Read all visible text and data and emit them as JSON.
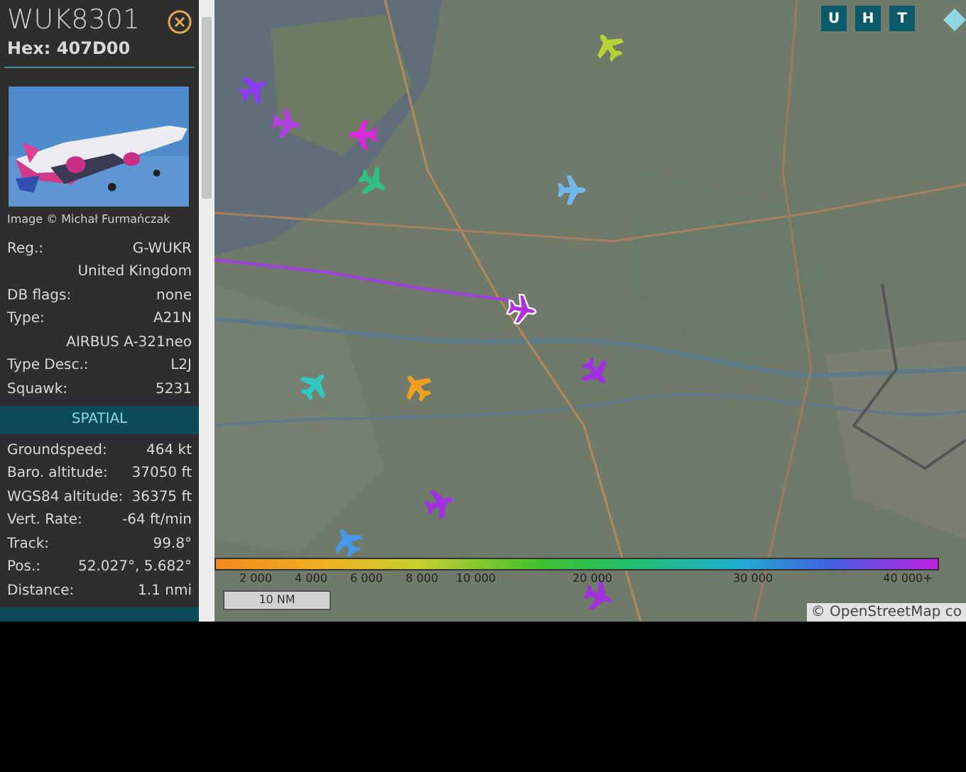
{
  "aircraft_panel": {
    "callsign": "WUK8301",
    "hex": "Hex: 407D00",
    "photo_credit": "Image © Michał Furmańczak",
    "rows": [
      {
        "label": "Reg.:",
        "value": "G-WUKR"
      },
      {
        "label": "",
        "value": "United Kingdom"
      },
      {
        "label": "DB flags:",
        "value": "none"
      },
      {
        "label": "Type:",
        "value": "A21N"
      },
      {
        "label": "",
        "value": "AIRBUS A-321neo"
      },
      {
        "label": "Type Desc.:",
        "value": "L2J"
      },
      {
        "label": "Squawk:",
        "value": "5231"
      }
    ],
    "section": "SPATIAL",
    "spatial_rows": [
      {
        "label": "Groundspeed:",
        "value": "464 kt"
      },
      {
        "label": "Baro. altitude:",
        "value": "37050 ft"
      },
      {
        "label": "WGS84 altitude:",
        "value": "36375 ft"
      },
      {
        "label": "Vert. Rate:",
        "value": "-64 ft/min"
      },
      {
        "label": "Track:",
        "value": "99.8°"
      },
      {
        "label": "Pos.:",
        "value": "52.027°, 5.682°"
      },
      {
        "label": "Distance:",
        "value": "1.1 nmi"
      }
    ]
  },
  "map_buttons": [
    "U",
    "H",
    "T"
  ],
  "aircraft": [
    {
      "color": "#b5d334",
      "selected": false
    },
    {
      "color": "#8b3cf0",
      "selected": false
    },
    {
      "color": "#b040e0",
      "selected": false
    },
    {
      "color": "#d828d8",
      "selected": false
    },
    {
      "color": "#30c080",
      "selected": false
    },
    {
      "color": "#70b8e8",
      "selected": false
    },
    {
      "color": "#b030e0",
      "selected": true
    },
    {
      "color": "#a030e0",
      "selected": false
    },
    {
      "color": "#30c8c0",
      "selected": false
    },
    {
      "color": "#f0a020",
      "selected": false
    },
    {
      "color": "#a030e0",
      "selected": false
    },
    {
      "color": "#4898e8",
      "selected": false
    },
    {
      "color": "#a030e0",
      "selected": false
    }
  ],
  "altitude_legend": [
    "2 000",
    "4 000",
    "6 000",
    "8 000",
    "10 000",
    "20 000",
    "30 000",
    "40 000+"
  ],
  "scale": "10 NM",
  "attribution": "© OpenStreetMap co"
}
